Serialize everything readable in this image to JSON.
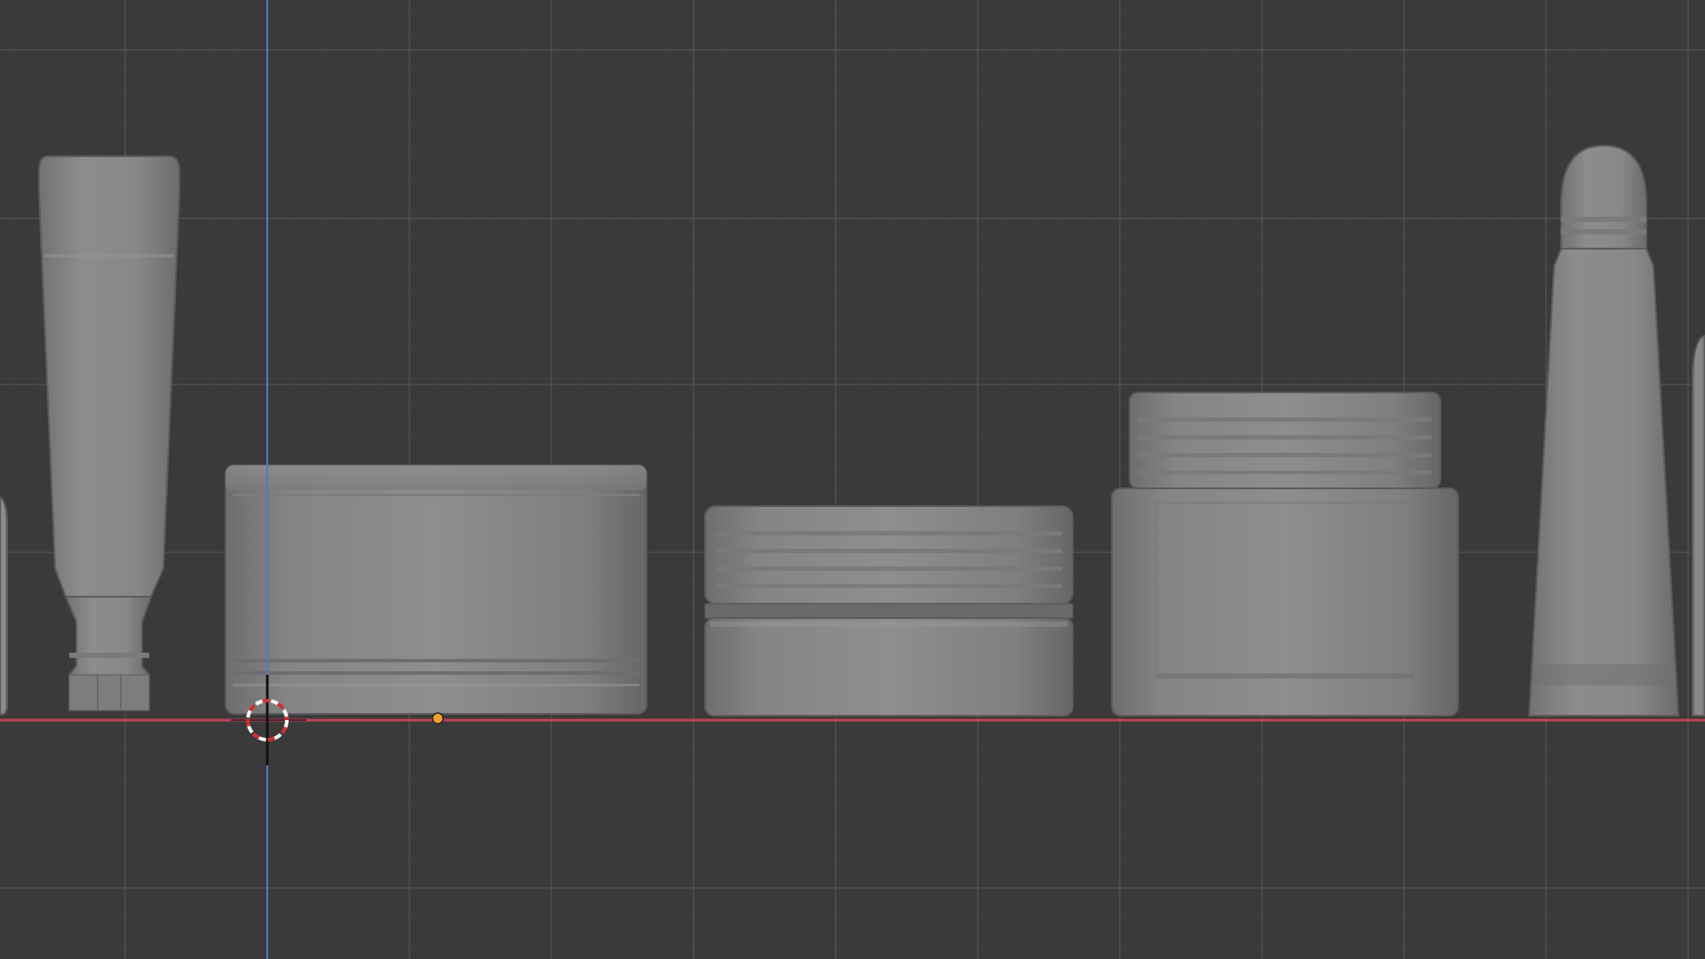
{
  "viewport": {
    "view": "front-orthographic",
    "background_color": "#3a3a3a",
    "grid_color": "#4f4f4f",
    "grid_major_color": "#555555",
    "x_axis_color": "#c0405a",
    "z_axis_color": "#4a7fc0",
    "object_color": "#8a8a8a",
    "origin_color": "#f0a030",
    "cursor_colors": [
      "#ffffff",
      "#d03030"
    ]
  },
  "objects": [
    {
      "name": "partial-object-left",
      "kind": "edge"
    },
    {
      "name": "tall-tube",
      "kind": "tube"
    },
    {
      "name": "wide-jar",
      "kind": "jar"
    },
    {
      "name": "short-jar",
      "kind": "jar"
    },
    {
      "name": "medium-jar",
      "kind": "jar"
    },
    {
      "name": "lip-gloss-tube",
      "kind": "tube"
    },
    {
      "name": "partial-object-right",
      "kind": "edge"
    }
  ],
  "tools": {
    "cursor": "3d-cursor-icon",
    "origin": "object-origin-icon"
  }
}
